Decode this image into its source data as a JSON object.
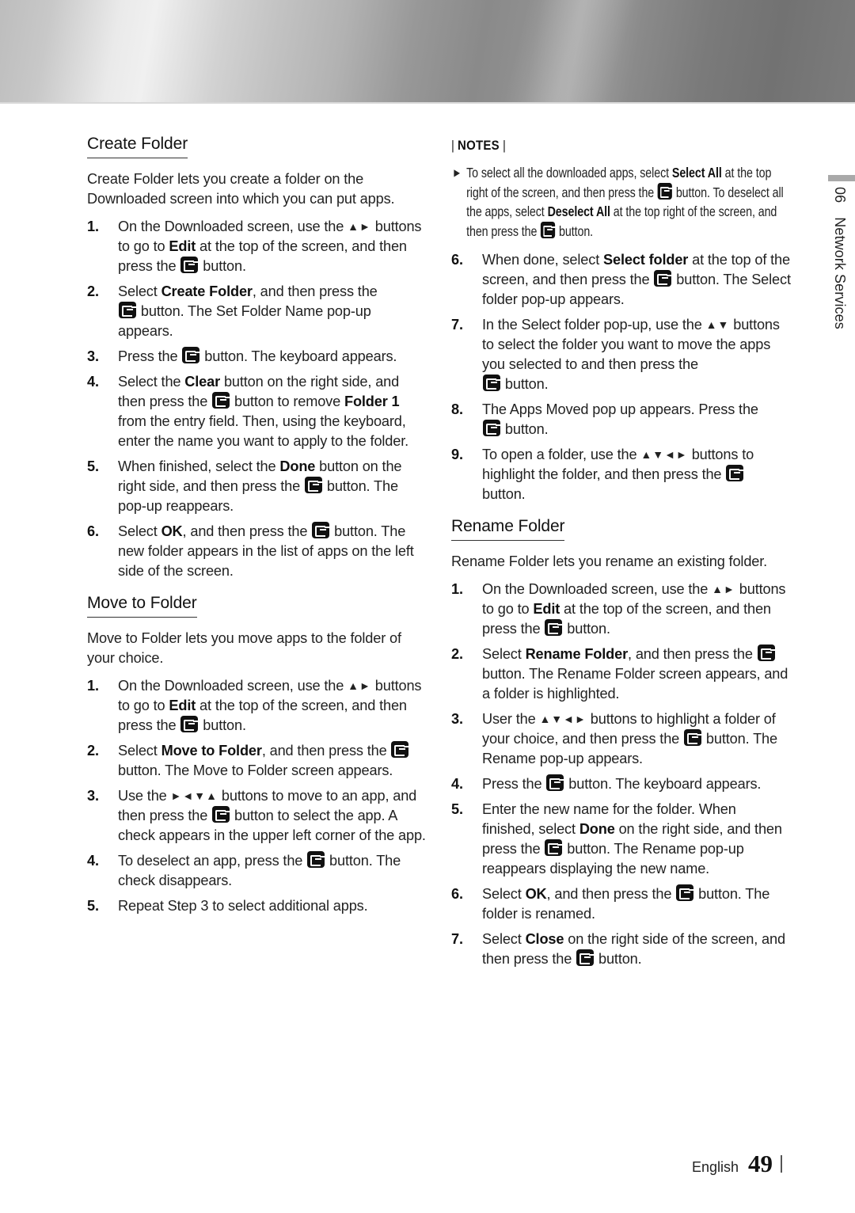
{
  "header": {
    "banner_icon": "metallic-banner"
  },
  "side_tab": {
    "chapter_number": "06",
    "chapter_title": "Network Services"
  },
  "footer": {
    "language": "English",
    "page_number": "49"
  },
  "icons": {
    "enter_button": "enter-button-icon",
    "up": "▲",
    "down": "▼",
    "left": "◀",
    "right": "▶",
    "note_bullet": "▶"
  },
  "create_folder": {
    "title": "Create Folder",
    "intro": "Create Folder lets you create a folder on the Downloaded screen into which you can put apps.",
    "steps": [
      {
        "num": "1.",
        "a": "On the Downloaded screen, use the ",
        "arrows": "▲►",
        "b": " buttons to go to ",
        "bold": "Edit",
        "c": " at the top of the screen, and then press the ",
        "d": " button."
      },
      {
        "num": "2.",
        "a": "Select ",
        "bold": "Create Folder",
        "b": ", and then press the ",
        "c": " button. The Set Folder Name pop-up appears."
      },
      {
        "num": "3.",
        "a": "Press the ",
        "b": " button. The keyboard appears."
      },
      {
        "num": "4.",
        "a": "Select the ",
        "bold": "Clear",
        "b": " button on the right side, and then press the ",
        "c": " button to remove ",
        "bold2": "Folder 1",
        "d": " from the entry field. Then, using the keyboard, enter the name you want to apply to the folder."
      },
      {
        "num": "5.",
        "a": "When finished, select the ",
        "bold": "Done",
        "b": " button on the right side, and then press the ",
        "c": " button. The pop-up reappears."
      },
      {
        "num": "6.",
        "a": "Select ",
        "bold": "OK",
        "b": ", and then press the ",
        "c": " button. The new folder appears in the list of apps on the left side of the screen."
      }
    ]
  },
  "move_to_folder": {
    "title": "Move to Folder",
    "intro": "Move to Folder lets you move apps to the folder of your choice.",
    "steps": [
      {
        "num": "1.",
        "a": "On the Downloaded screen, use the ",
        "arrows": "▲►",
        "b": " buttons to go to ",
        "bold": "Edit",
        "c": " at the top of the screen, and then press the ",
        "d": " button."
      },
      {
        "num": "2.",
        "a": "Select ",
        "bold": "Move to Folder",
        "b": ", and then press the ",
        "c": " button. The Move to Folder screen appears."
      },
      {
        "num": "3.",
        "a": "Use the ",
        "arrows": "►◄▼▲",
        "b": " buttons to move to an app, and then press the ",
        "c": " button to select the app. A check appears in the upper left corner of the app."
      },
      {
        "num": "4.",
        "a": "To deselect an app, press the ",
        "b": " button. The check disappears."
      },
      {
        "num": "5.",
        "a": "Repeat Step 3 to select additional apps."
      },
      {
        "num": "6.",
        "a": "When done, select ",
        "bold": "Select folder",
        "b": " at the top of the screen, and then press the ",
        "c": " button. The Select folder pop-up appears."
      },
      {
        "num": "7.",
        "a": "In the Select folder pop-up, use the ",
        "arrows": "▲▼",
        "b": " buttons to select the folder you want to move the apps you selected to and then press the ",
        "c": " button."
      },
      {
        "num": "8.",
        "a": "The Apps Moved pop up appears. Press the ",
        "b": " button."
      },
      {
        "num": "9.",
        "a": "To open a folder, use the ",
        "arrows": "▲▼◄►",
        "b": " buttons to highlight the folder, and then press the ",
        "c": " button."
      }
    ],
    "notes_label": "NOTES",
    "note": {
      "a": "To select all the downloaded apps, select ",
      "bold": "Select All",
      "b": " at the top right of the screen, and then press the ",
      "c": " button. To deselect all the apps, select ",
      "bold2": "Deselect All",
      "d": " at the top right of the screen, and then press the ",
      "e": " button."
    }
  },
  "rename_folder": {
    "title": "Rename Folder",
    "intro": "Rename Folder lets you rename an existing folder.",
    "steps": [
      {
        "num": "1.",
        "a": "On the Downloaded screen, use the ",
        "arrows": "▲►",
        "b": " buttons to go to ",
        "bold": "Edit",
        "c": " at the top of the screen, and then press the ",
        "d": " button."
      },
      {
        "num": "2.",
        "a": "Select ",
        "bold": "Rename Folder",
        "b": ", and then press the ",
        "c": " button. The Rename Folder screen appears, and a folder is highlighted."
      },
      {
        "num": "3.",
        "a": "User the ",
        "arrows": "▲▼◄►",
        "b": " buttons to highlight a folder of your choice, and then press the ",
        "c": " button. The Rename pop-up appears."
      },
      {
        "num": "4.",
        "a": "Press the ",
        "b": " button. The keyboard appears."
      },
      {
        "num": "5.",
        "a": "Enter the new name for the folder. When finished, select ",
        "bold": "Done",
        "b": " on the right side, and then press the ",
        "c": " button. The Rename pop-up reappears displaying the new name."
      },
      {
        "num": "6.",
        "a": "Select ",
        "bold": "OK",
        "b": ", and then press the ",
        "c": " button. The folder is renamed."
      },
      {
        "num": "7.",
        "a": "Select ",
        "bold": "Close",
        "b": " on the right side of the screen, and then press the ",
        "c": " button."
      }
    ]
  }
}
